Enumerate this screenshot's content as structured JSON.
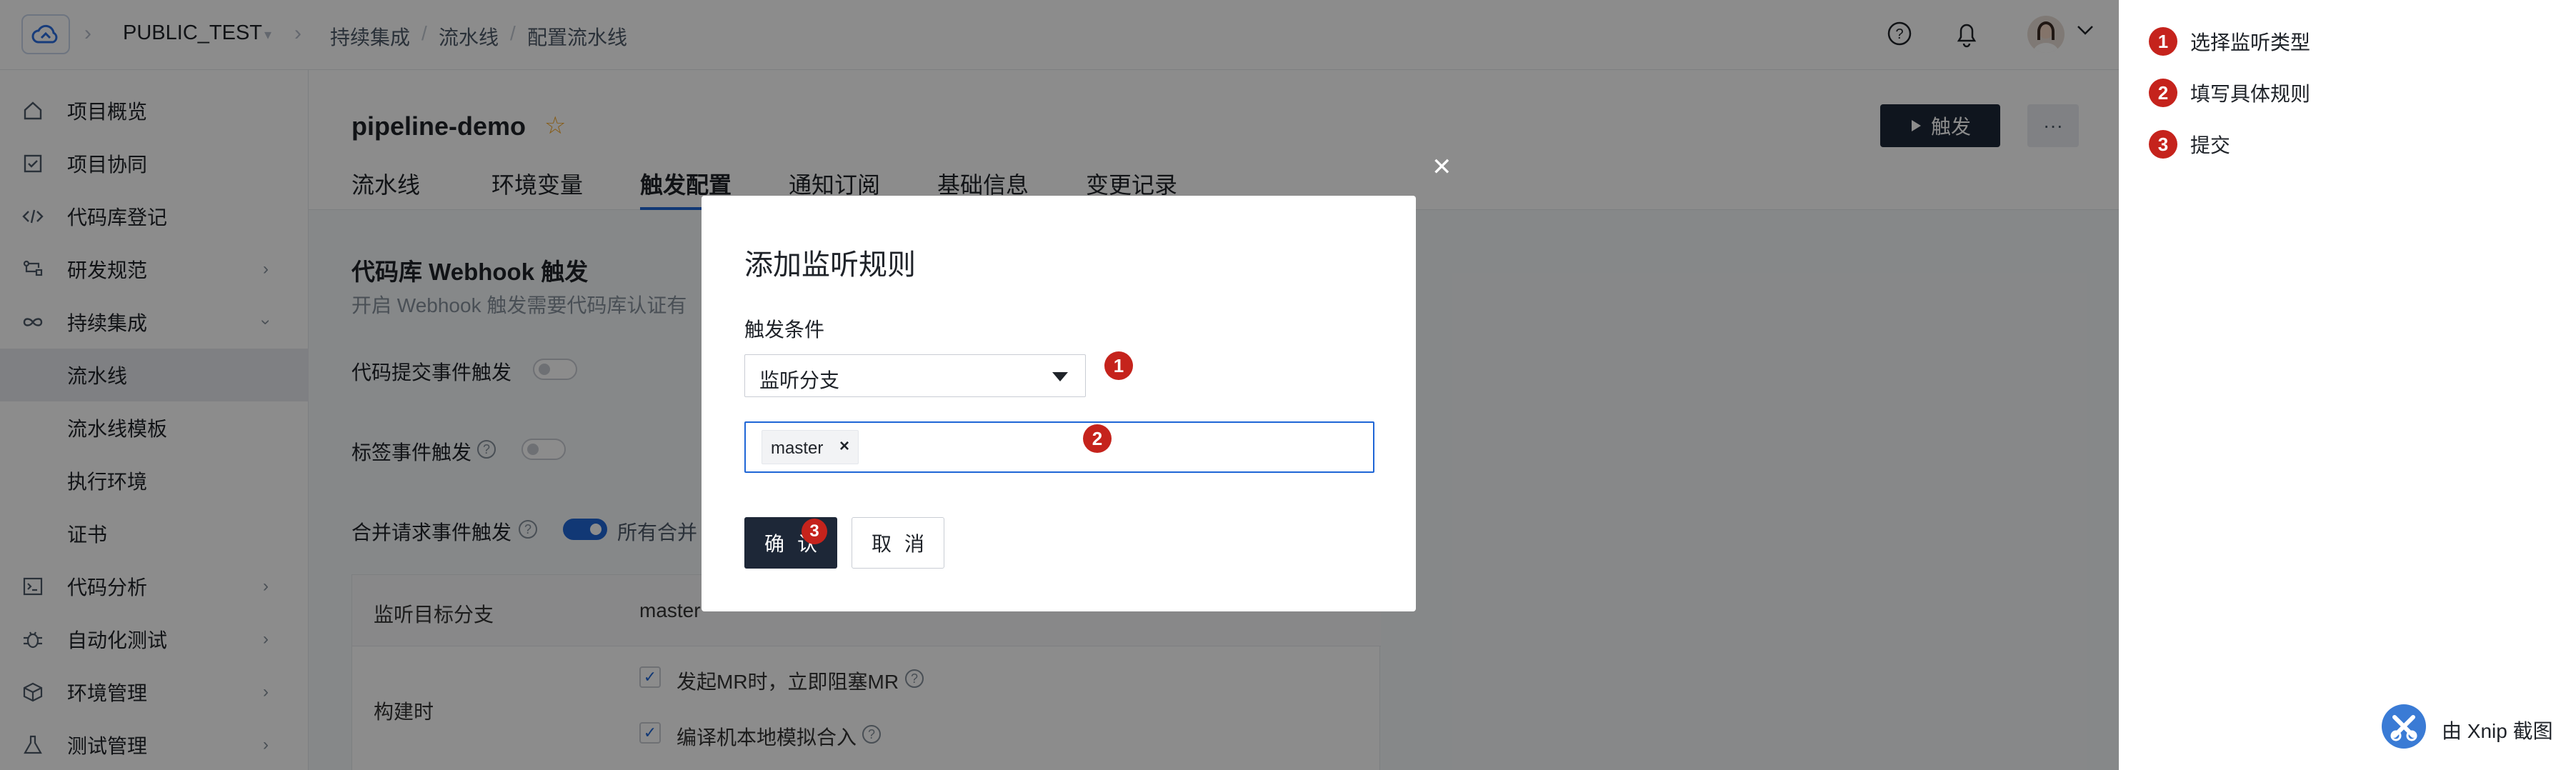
{
  "topbar": {
    "project": "PUBLIC_TEST",
    "breadcrumb": [
      "持续集成",
      "流水线",
      "配置流水线"
    ]
  },
  "sidebar": {
    "items": [
      {
        "label": "项目概览",
        "icon": "home-icon"
      },
      {
        "label": "项目协同",
        "icon": "checkbox-icon"
      },
      {
        "label": "代码库登记",
        "icon": "code-icon"
      },
      {
        "label": "研发规范",
        "icon": "flow-icon"
      },
      {
        "label": "持续集成",
        "icon": "infinity-icon"
      },
      {
        "label": "代码分析",
        "icon": "terminal-icon"
      },
      {
        "label": "自动化测试",
        "icon": "bug-icon"
      },
      {
        "label": "环境管理",
        "icon": "cube-icon"
      },
      {
        "label": "测试管理",
        "icon": "flask-icon"
      }
    ],
    "sub_items": [
      "流水线",
      "流水线模板",
      "执行环境",
      "证书"
    ]
  },
  "header": {
    "title": "pipeline-demo",
    "run_label": "触发",
    "more_label": "···",
    "tabs": [
      "流水线",
      "环境变量",
      "触发配置",
      "通知订阅",
      "基础信息",
      "变更记录"
    ]
  },
  "content": {
    "section_title": "代码库 Webhook 触发",
    "section_desc": "开启 Webhook 触发需要代码库认证有",
    "push_trigger": "代码提交事件触发",
    "tag_trigger": "标签事件触发",
    "mr_trigger": "合并请求事件触发",
    "mr_all": "所有合并",
    "target_branch_label": "监听目标分支",
    "target_branch_value": "master",
    "build_label": "构建时",
    "check1": "发起MR时，立即阻塞MR",
    "check2": "编译机本地模拟合入"
  },
  "modal": {
    "title": "添加监听规则",
    "condition_label": "触发条件",
    "select_value": "监听分支",
    "tag_value": "master",
    "ok_label": "确认",
    "cancel_label": "取消"
  },
  "annotations": {
    "badges": [
      "1",
      "2",
      "3"
    ],
    "legend": [
      {
        "num": "1",
        "text": "选择监听类型"
      },
      {
        "num": "2",
        "text": "填写具体规则"
      },
      {
        "num": "3",
        "text": "提交"
      }
    ],
    "capture_label": "由 Xnip 截图",
    "badge_color": "#c5231c"
  }
}
